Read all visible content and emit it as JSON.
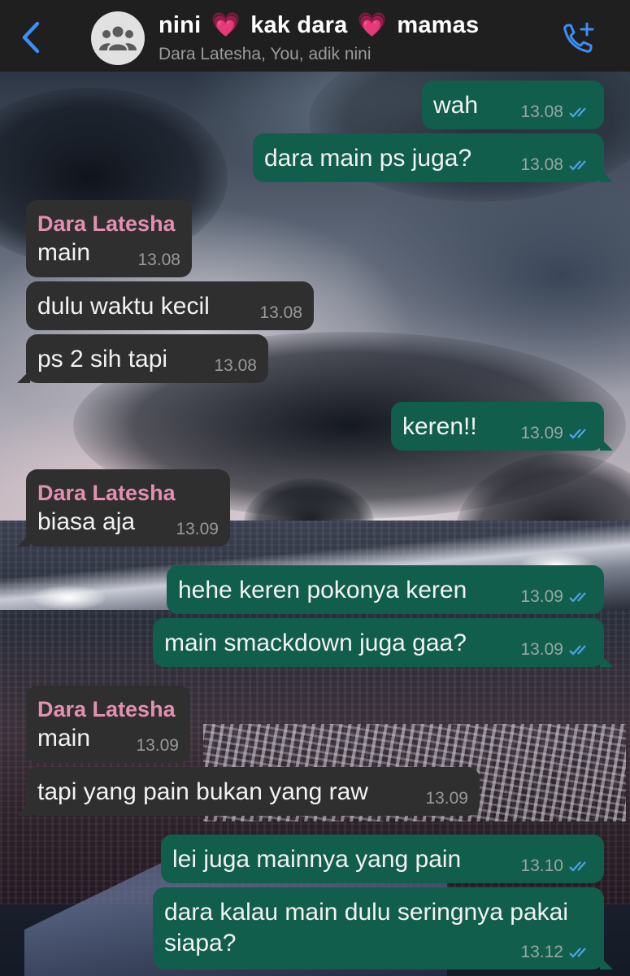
{
  "header": {
    "back_icon": "chevron-left-icon",
    "avatar_icon": "group-icon",
    "title_parts": [
      "nini",
      "💗",
      "kak dara",
      "💗",
      "mamas"
    ],
    "subtitle": "Dara Latesha, You, adik nini",
    "call_icon": "add-call-icon",
    "accent_color": "#3b8ff5"
  },
  "colors": {
    "outgoing_bubble": "#115e4d",
    "incoming_bubble": "#2f2f2f",
    "sender_name": "#e48fb2",
    "read_ticks": "#4fa3e8"
  },
  "messages": [
    {
      "direction": "out",
      "text": "wah",
      "time": "13.08",
      "status": "read"
    },
    {
      "direction": "out",
      "text": "dara main ps juga?",
      "time": "13.08",
      "status": "read"
    },
    {
      "direction": "in",
      "sender": "Dara Latesha",
      "text": "main",
      "time": "13.08"
    },
    {
      "direction": "in",
      "text": "dulu waktu kecil",
      "time": "13.08"
    },
    {
      "direction": "in",
      "text": "ps 2 sih tapi",
      "time": "13.08"
    },
    {
      "direction": "out",
      "text": "keren!!",
      "time": "13.09",
      "status": "read"
    },
    {
      "direction": "in",
      "sender": "Dara Latesha",
      "text": "biasa aja",
      "time": "13.09"
    },
    {
      "direction": "out",
      "text": "hehe keren pokonya keren",
      "time": "13.09",
      "status": "read"
    },
    {
      "direction": "out",
      "text": "main smackdown juga gaa?",
      "time": "13.09",
      "status": "read"
    },
    {
      "direction": "in",
      "sender": "Dara Latesha",
      "text": "main",
      "time": "13.09"
    },
    {
      "direction": "in",
      "text": "tapi yang pain bukan yang raw",
      "time": "13.09"
    },
    {
      "direction": "out",
      "text": "lei juga mainnya yang pain",
      "time": "13.10",
      "status": "read"
    },
    {
      "direction": "out",
      "text": "dara kalau main dulu seringnya pakai siapa?",
      "time": "13.12",
      "status": "read"
    }
  ]
}
